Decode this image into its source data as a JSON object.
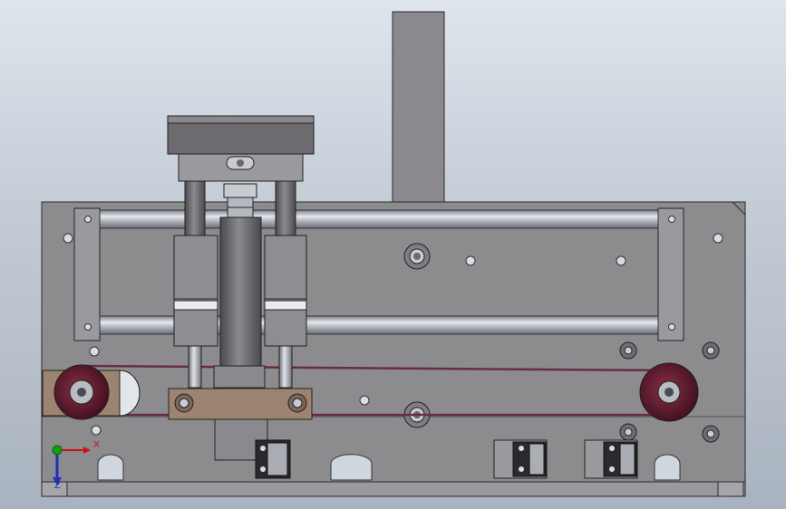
{
  "viewport": {
    "background_top": "#dfe5ec",
    "background_bottom": "#a9b3bf"
  },
  "model": {
    "part_color": "#8c8c8f",
    "part_edge": "#2a2a2a",
    "rod_color": "#b8bcc4",
    "pulley_color": "#5a1a2c",
    "belt_color": "#6a2a4a",
    "bracket_color": "#9c8470"
  },
  "triad": {
    "x_label": "X",
    "z_label": "Z",
    "x_color": "#d01010",
    "y_color": "#10a010",
    "z_color": "#2030c0"
  }
}
